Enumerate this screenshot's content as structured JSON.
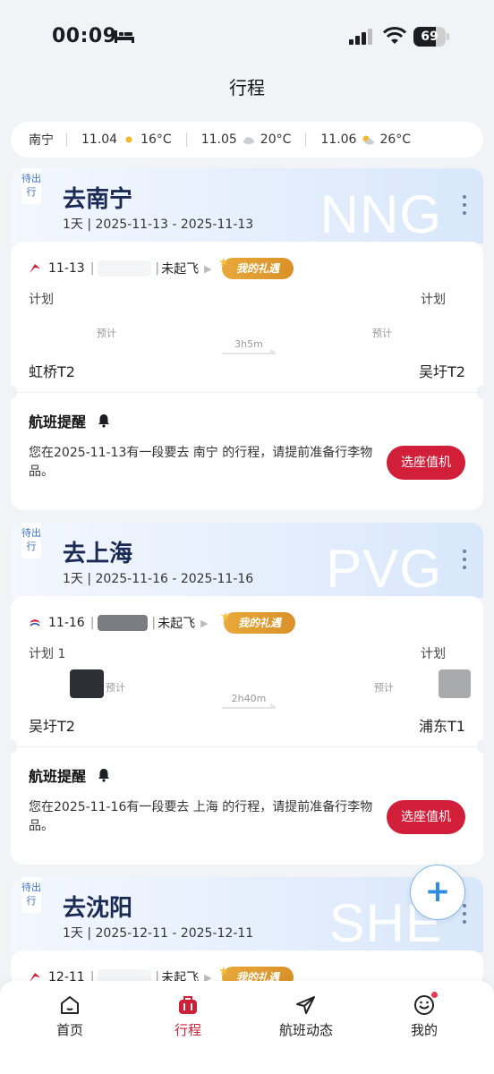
{
  "status_bar": {
    "time": "00:09",
    "battery": "69",
    "battery_level": 0.69
  },
  "page": {
    "title": "行程"
  },
  "weather": {
    "city": "南宁",
    "days": [
      {
        "date": "11.04",
        "icon": "sun-icon",
        "temp": "16°C"
      },
      {
        "date": "11.05",
        "icon": "cloud-icon",
        "temp": "20°C"
      },
      {
        "date": "11.06",
        "icon": "partly-cloudy-icon",
        "temp": "26°C"
      }
    ]
  },
  "trips": [
    {
      "status": "待出行",
      "title": "去南宁",
      "dates": "1天 | 2025-11-13 - 2025-11-13",
      "code": "NNG",
      "flight": {
        "date": "11-13",
        "state": "未起飞",
        "gift": "我的礼遇",
        "plan_dep": "计划",
        "plan_arr": "计划",
        "expect_dep": "预计",
        "expect_arr": "预计",
        "duration": "3h5m",
        "dep_airport": "虹桥T2",
        "arr_airport": "吴圩T2"
      },
      "reminder": {
        "title": "航班提醒",
        "text": "您在2025-11-13有一段要去 南宁 的行程，请提前准备行李物品。",
        "button": "选座值机"
      }
    },
    {
      "status": "待出行",
      "title": "去上海",
      "dates": "1天 | 2025-11-16 - 2025-11-16",
      "code": "PVG",
      "flight": {
        "date": "11-16",
        "state": "未起飞",
        "gift": "我的礼遇",
        "plan_dep": "计划 1",
        "plan_arr": "计划",
        "expect_dep": "预计",
        "expect_arr": "预计",
        "duration": "2h40m",
        "dep_airport": "吴圩T2",
        "arr_airport": "浦东T1"
      },
      "reminder": {
        "title": "航班提醒",
        "text": "您在2025-11-16有一段要去 上海 的行程，请提前准备行李物品。",
        "button": "选座值机"
      }
    },
    {
      "status": "待出行",
      "title": "去沈阳",
      "dates": "1天 | 2025-12-11 - 2025-12-11",
      "code": "SHE",
      "flight": {
        "date": "12-11",
        "state": "未起飞",
        "gift": "我的礼遇"
      }
    }
  ],
  "fab": {
    "label": "+"
  },
  "tabs": [
    {
      "label": "首页",
      "icon": "home-icon"
    },
    {
      "label": "行程",
      "icon": "suitcase-icon"
    },
    {
      "label": "航班动态",
      "icon": "paper-plane-icon"
    },
    {
      "label": "我的",
      "icon": "smiley-icon"
    }
  ],
  "colors": {
    "accent": "#d11f3a",
    "title_blue": "#1a2a55",
    "gift": "#e8a93a"
  }
}
